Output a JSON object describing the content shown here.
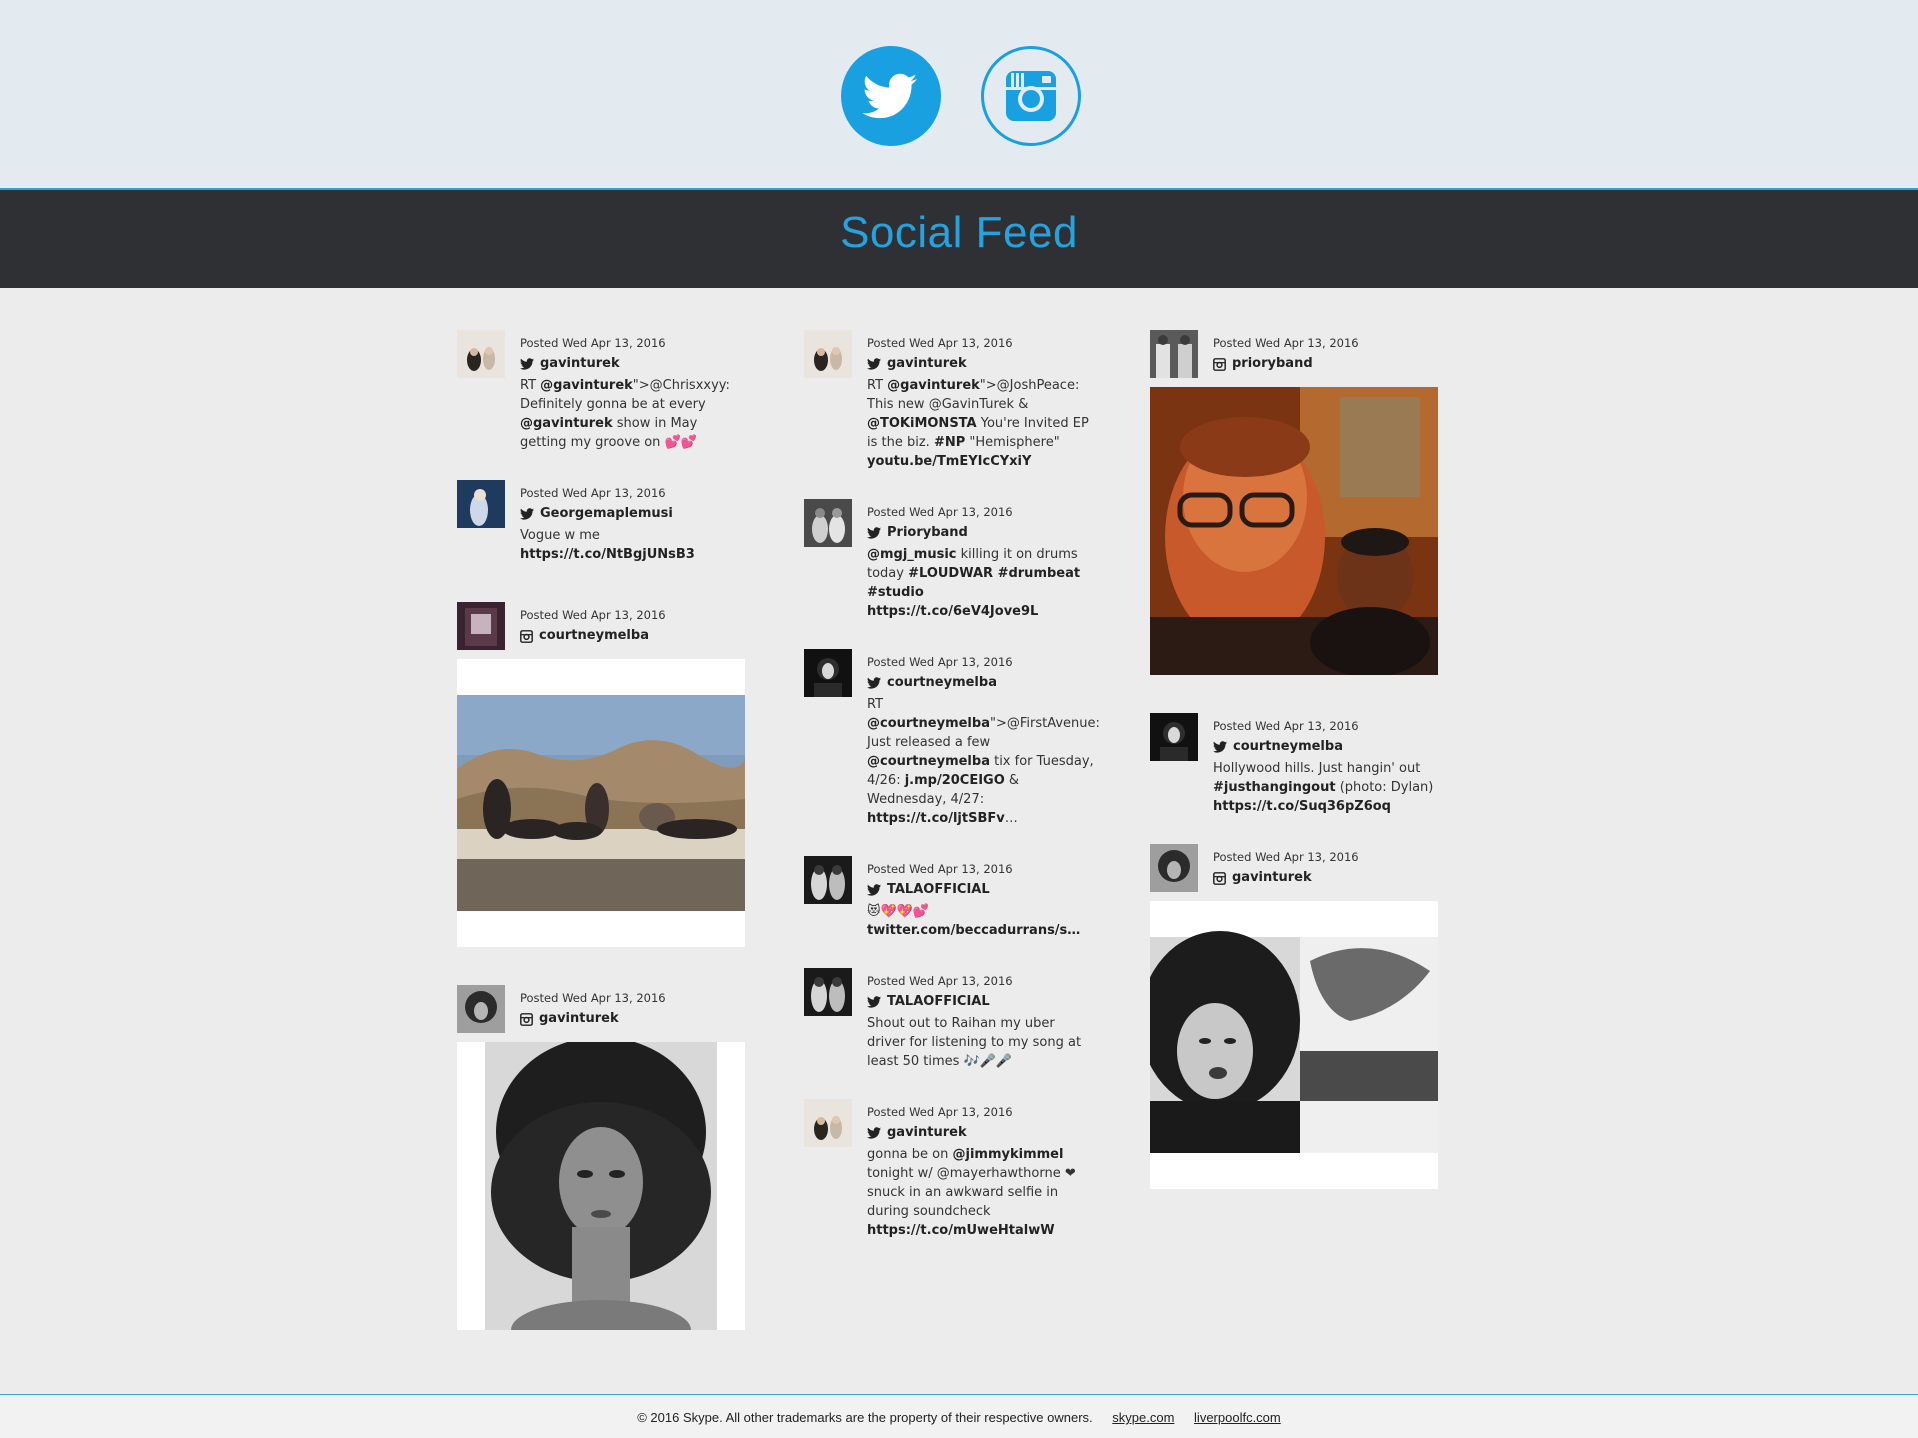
{
  "header": {
    "twitter_icon": "twitter-bird-icon",
    "instagram_icon": "instagram-camera-icon",
    "accent": "#19a0e0"
  },
  "banner": {
    "title": "Social Feed",
    "bg": "#2e3034",
    "title_color": "#24a3e0"
  },
  "columns": [
    [
      {
        "posted": "Posted Wed Apr 13, 2016",
        "network": "twitter",
        "user": "gavinturek",
        "text_parts": [
          "RT ",
          "@gavinturek",
          "\">@Chrisxxyy: Definitely gonna be at every ",
          "@gavinturek",
          " show in May getting my groove on 💕💕"
        ]
      },
      {
        "posted": "Posted Wed Apr 13, 2016",
        "network": "twitter",
        "user": "Georgemaplemusi",
        "text_parts": [
          "Vogue w me ",
          "https://t.co/NtBgjUNsB3"
        ]
      },
      {
        "posted": "Posted Wed Apr 13, 2016",
        "network": "instagram",
        "user": "courtneymelba"
      },
      {
        "posted": "Posted Wed Apr 13, 2016",
        "network": "instagram",
        "user": "gavinturek"
      }
    ],
    [
      {
        "posted": "Posted Wed Apr 13, 2016",
        "network": "twitter",
        "user": "gavinturek",
        "text_parts": [
          "RT ",
          "@gavinturek",
          "\">@JoshPeace: This new @GavinTurek & ",
          "@TOKiMONSTA",
          " You're Invited EP is the biz. ",
          "#NP",
          " \"Hemisphere\" ",
          "youtu.be/TmEYIcCYxiY"
        ]
      },
      {
        "posted": "Posted Wed Apr 13, 2016",
        "network": "twitter",
        "user": "Prioryband",
        "text_parts": [
          "@mgj_music",
          " killing it on drums today ",
          "#LOUDWAR #drumbeat #studio https://t.co/6eV4Jove9L"
        ]
      },
      {
        "posted": "Posted Wed Apr 13, 2016",
        "network": "twitter",
        "user": "courtneymelba",
        "text_parts": [
          "RT ",
          "@courtneymelba",
          "\">@FirstAvenue: Just released a few ",
          "@courtneymelba",
          " tix for Tuesday, 4/26: ",
          "j.mp/20CEIGO",
          " & Wednesday, 4/27: ",
          "https://t.co/ljtSBFv",
          "…"
        ]
      },
      {
        "posted": "Posted Wed Apr 13, 2016",
        "network": "twitter",
        "user": "TALAOFFICIAL",
        "text_parts": [
          "😻💖💖💕 ",
          "twitter.com/beccadurrans/s…"
        ]
      },
      {
        "posted": "Posted Wed Apr 13, 2016",
        "network": "twitter",
        "user": "TALAOFFICIAL",
        "text_parts": [
          "Shout out to Raihan my uber driver for listening to my song at least 50 times 🎶🎤🎤"
        ]
      },
      {
        "posted": "Posted Wed Apr 13, 2016",
        "network": "twitter",
        "user": "gavinturek",
        "text_parts": [
          "gonna be on ",
          "@jimmykimmel",
          " tonight w/ @mayerhawthorne ❤ snuck in an awkward selfie in during soundcheck ",
          "https://t.co/mUweHtalwW"
        ]
      }
    ],
    [
      {
        "posted": "Posted Wed Apr 13, 2016",
        "network": "instagram",
        "user": "prioryband"
      },
      {
        "posted": "Posted Wed Apr 13, 2016",
        "network": "twitter",
        "user": "courtneymelba",
        "text_parts": [
          "Hollywood hills. Just hangin' out ",
          "#justhangingout",
          " (photo: Dylan) ",
          "https://t.co/Suq36pZ6oq"
        ]
      },
      {
        "posted": "Posted Wed Apr 13, 2016",
        "network": "instagram",
        "user": "gavinturek"
      }
    ]
  ],
  "footer": {
    "copyright": "© 2016 Skype. All other trademarks are the property of their respective owners.",
    "link1": "skype.com",
    "link2": "liverpoolfc.com"
  }
}
